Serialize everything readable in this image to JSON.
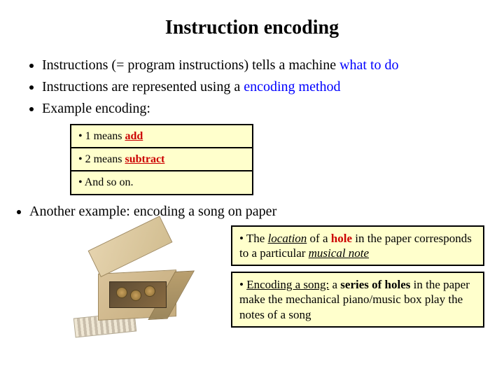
{
  "title": "Instruction encoding",
  "bullets": {
    "b1_pre": "Instructions (= program instructions) tells a machine ",
    "b1_hi": "what to do",
    "b2_pre": "Instructions are represented using a ",
    "b2_hi": "encoding method",
    "b3": "Example encoding:"
  },
  "encoding": {
    "r1_pre": "• 1 means ",
    "r1_hi": "add",
    "r2_pre": "• 2 means ",
    "r2_hi": "subtract",
    "r3": "• And so on."
  },
  "second": "Another example: encoding a song on paper",
  "noteA": {
    "p1": "• The ",
    "loc": "location",
    "p2": " of a ",
    "hole": "hole",
    "p3": " in the paper corresponds to a particular ",
    "mn": "musical note"
  },
  "noteB": {
    "p1": "• ",
    "enc": "Encoding a song:",
    "p2": " a ",
    "series": "series of holes",
    "p3": " in the paper make the mechanical piano/music box play the notes of a song"
  }
}
